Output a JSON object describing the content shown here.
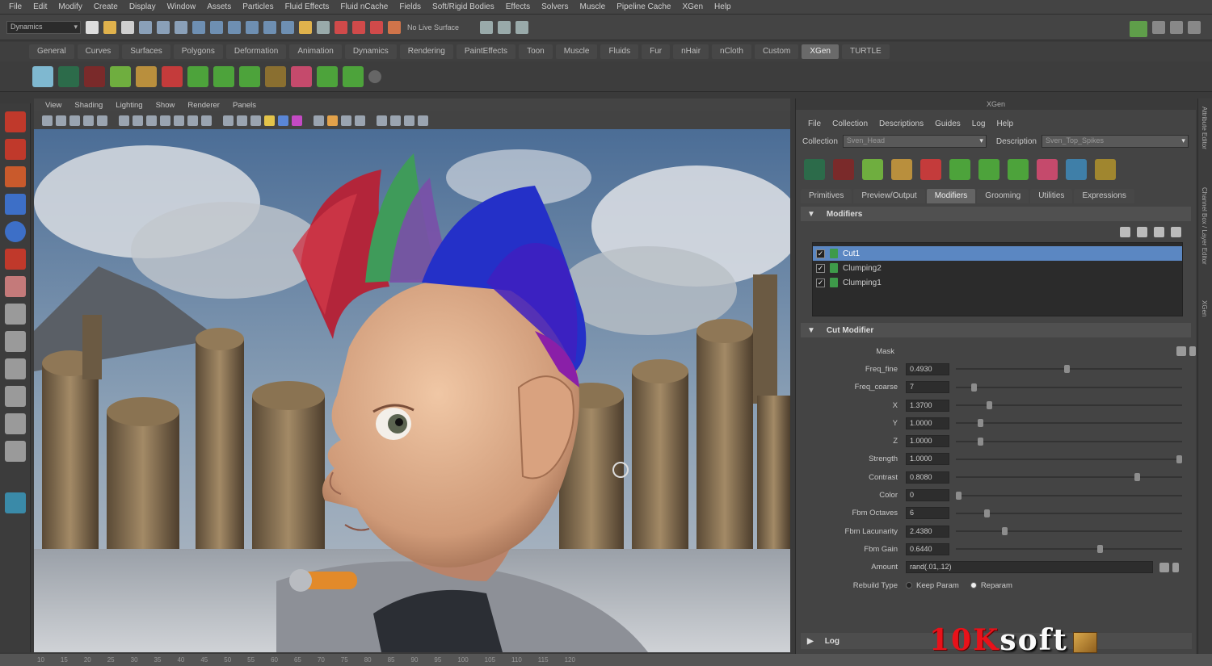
{
  "menu": [
    "File",
    "Edit",
    "Modify",
    "Create",
    "Display",
    "Window",
    "Assets",
    "Particles",
    "Fluid Effects",
    "Fluid nCache",
    "Fields",
    "Soft/Rigid Bodies",
    "Effects",
    "Solvers",
    "Muscle",
    "Pipeline Cache",
    "XGen",
    "Help"
  ],
  "status": {
    "mode": "Dynamics",
    "live_surface": "No Live Surface"
  },
  "shelf_tabs": [
    "General",
    "Curves",
    "Surfaces",
    "Polygons",
    "Deformation",
    "Animation",
    "Dynamics",
    "Rendering",
    "PaintEffects",
    "Toon",
    "Muscle",
    "Fluids",
    "Fur",
    "nHair",
    "nCloth",
    "Custom",
    "XGen",
    "TURTLE"
  ],
  "shelf_active": "XGen",
  "viewport": {
    "menu": [
      "View",
      "Shading",
      "Lighting",
      "Show",
      "Renderer",
      "Panels"
    ]
  },
  "timeline_ticks": [
    "10",
    "15",
    "20",
    "25",
    "30",
    "35",
    "40",
    "45",
    "50",
    "55",
    "60",
    "65",
    "70",
    "75",
    "80",
    "85",
    "90",
    "95",
    "100",
    "105",
    "110",
    "115",
    "120"
  ],
  "xgen": {
    "title": "XGen",
    "menu": [
      "File",
      "Collection",
      "Descriptions",
      "Guides",
      "Log",
      "Help"
    ],
    "collection_label": "Collection",
    "collection_value": "Sven_Head",
    "description_label": "Description",
    "description_value": "Sven_Top_Spikes",
    "tabs": [
      "Primitives",
      "Preview/Output",
      "Modifiers",
      "Grooming",
      "Utilities",
      "Expressions"
    ],
    "active_tab": "Modifiers",
    "modifiers_header": "Modifiers",
    "modifiers": [
      {
        "name": "Cut1",
        "checked": true,
        "selected": true
      },
      {
        "name": "Clumping2",
        "checked": true,
        "selected": false
      },
      {
        "name": "Clumping1",
        "checked": true,
        "selected": false
      }
    ],
    "cut_header": "Cut Modifier",
    "mask_label": "Mask",
    "params": [
      {
        "label": "Freq_fine",
        "value": "0.4930",
        "pos": 0.49
      },
      {
        "label": "Freq_coarse",
        "value": "7",
        "pos": 0.07
      },
      {
        "label": "X",
        "value": "1.3700",
        "pos": 0.14
      },
      {
        "label": "Y",
        "value": "1.0000",
        "pos": 0.1
      },
      {
        "label": "Z",
        "value": "1.0000",
        "pos": 0.1
      },
      {
        "label": "Strength",
        "value": "1.0000",
        "pos": 1.0
      },
      {
        "label": "Contrast",
        "value": "0.8080",
        "pos": 0.81
      },
      {
        "label": "Color",
        "value": "0",
        "pos": 0.0
      },
      {
        "label": "Fbm Octaves",
        "value": "6",
        "pos": 0.13
      },
      {
        "label": "Fbm Lacunarity",
        "value": "2.4380",
        "pos": 0.21
      },
      {
        "label": "Fbm Gain",
        "value": "0.6440",
        "pos": 0.64
      }
    ],
    "amount_label": "Amount",
    "amount_value": "rand(.01,.12)",
    "rebuild_label": "Rebuild Type",
    "rebuild_options": [
      "Keep Param",
      "Reparam"
    ],
    "log_label": "Log"
  },
  "side_strip": [
    "Attribute Editor",
    "Channel Box / Layer Editor",
    "XGen"
  ],
  "watermark": {
    "red": "10K",
    "white": "soft"
  }
}
